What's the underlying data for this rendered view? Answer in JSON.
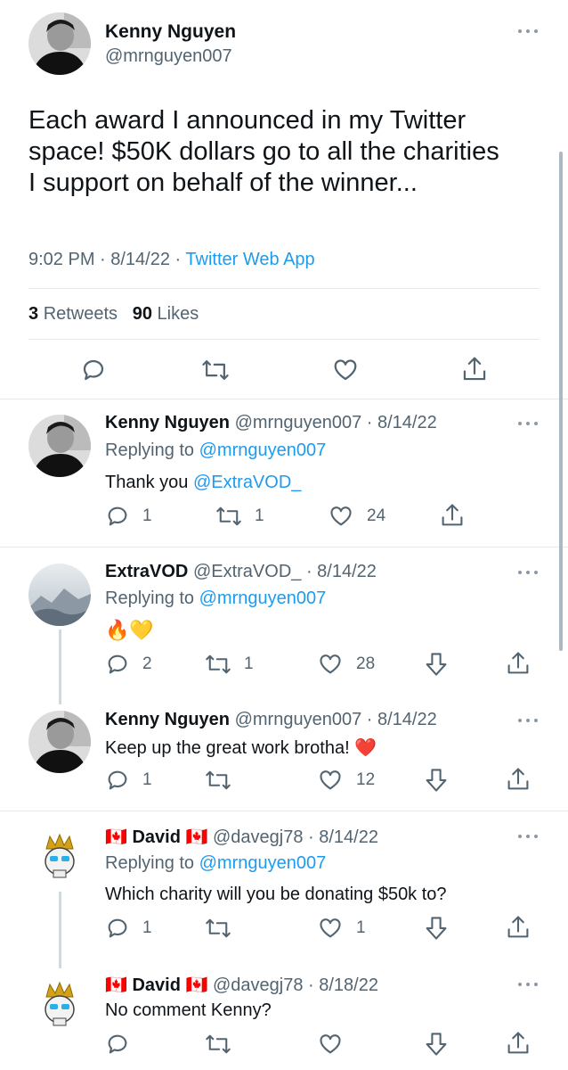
{
  "main_tweet": {
    "name": "Kenny Nguyen",
    "handle": "@mrnguyen007",
    "text_lines": [
      "Each award I announced in my Twitter",
      "space! $50K dollars go to all the charities",
      "I support on behalf of the winner..."
    ],
    "timestamp": "9:02 PM · 8/14/22 · ",
    "source": "Twitter Web App",
    "retweets_count": "3",
    "retweets_label": "Retweets",
    "likes_count": "90",
    "likes_label": "Likes"
  },
  "replies": [
    {
      "name": "Kenny Nguyen",
      "meta": "@mrnguyen007 · 8/14/22",
      "replying_prefix": "Replying to ",
      "replying_to": "@mrnguyen007",
      "text": "Thank you ",
      "text_mention": "@ExtraVOD_",
      "replies": "1",
      "retweets": "1",
      "likes": "24"
    },
    {
      "name": "ExtraVOD",
      "meta": "@ExtraVOD_ · 8/14/22",
      "replying_prefix": "Replying to ",
      "replying_to": "@mrnguyen007",
      "text": "🔥💛",
      "replies": "2",
      "retweets": "1",
      "likes": "28"
    },
    {
      "name": "Kenny Nguyen",
      "meta": "@mrnguyen007 · 8/14/22",
      "text": "Keep up the great work brotha! ❤️",
      "replies": "1",
      "retweets": "",
      "likes": "12"
    },
    {
      "name": "🇨🇦 David 🇨🇦",
      "meta": "@davegj78 · 8/14/22",
      "replying_prefix": "Replying to ",
      "replying_to": "@mrnguyen007",
      "text": "Which charity will you be donating $50k to?",
      "replies": "1",
      "retweets": "",
      "likes": "1"
    },
    {
      "name": "🇨🇦 David 🇨🇦",
      "meta": "@davegj78 · 8/18/22",
      "text": "No comment Kenny?",
      "replies": "",
      "retweets": "",
      "likes": ""
    }
  ],
  "colors": {
    "accent": "#1d9bf0",
    "muted": "#536471",
    "divider": "#e6e9ec"
  }
}
